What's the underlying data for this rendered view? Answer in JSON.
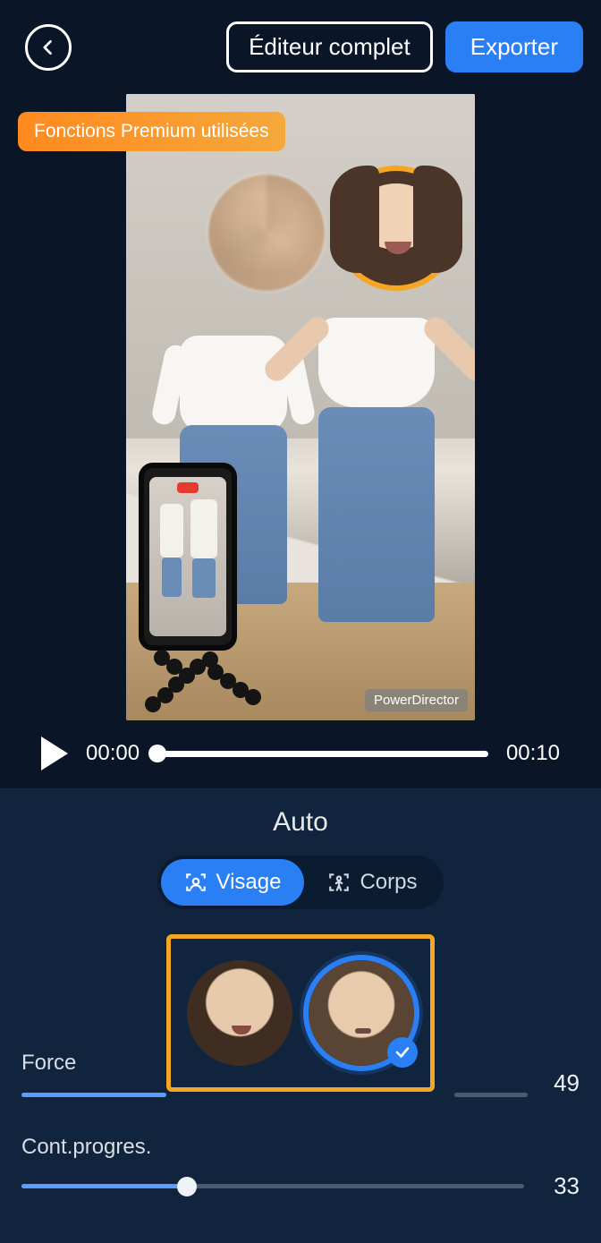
{
  "header": {
    "editor_label": "Éditeur complet",
    "export_label": "Exporter"
  },
  "premium_badge": "Fonctions Premium utilisées",
  "watermark": "PowerDirector",
  "playback": {
    "current": "00:00",
    "total": "00:10"
  },
  "panel": {
    "title": "Auto",
    "tabs": {
      "face": "Visage",
      "body": "Corps",
      "active": "face"
    },
    "sliders": {
      "force": {
        "label": "Force",
        "value": 49
      },
      "feather": {
        "label": "Cont.progres.",
        "value": 33
      }
    }
  }
}
